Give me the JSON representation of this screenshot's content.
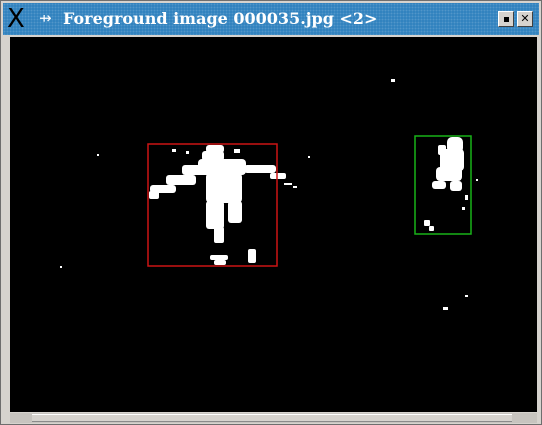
{
  "window": {
    "title": "Foreground image 000035.jpg <2>",
    "icons": {
      "menu": "x-logo-icon",
      "pin": "pin-icon",
      "minimize": "minimize-icon",
      "close": "close-icon"
    },
    "glyphs": {
      "menu": "X",
      "pin": "⇸",
      "close": "✕"
    }
  },
  "colors": {
    "titlebar": "#2b7fbd",
    "canvas_background": "#000000",
    "foreground": "#ffffff",
    "box_person_1": "#cc1414",
    "box_person_2": "#19b219"
  }
}
